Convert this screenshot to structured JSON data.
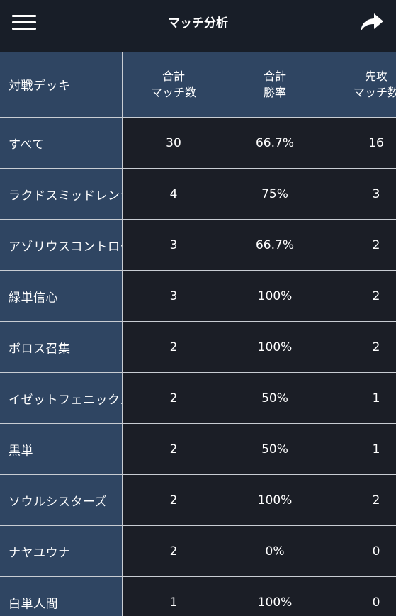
{
  "header": {
    "title": "マッチ分析"
  },
  "table": {
    "columns": {
      "deck": "対戦デッキ",
      "total_matches": [
        "合計",
        "マッチ数"
      ],
      "total_winrate": [
        "合計",
        "勝率"
      ],
      "first_matches": [
        "先攻",
        "マッチ数"
      ]
    },
    "rows": [
      {
        "deck": "すべて",
        "total": "30",
        "winrate": "66.7%",
        "first": "16"
      },
      {
        "deck": "ラクドスミッドレンジ",
        "total": "4",
        "winrate": "75%",
        "first": "3"
      },
      {
        "deck": "アゾリウスコントロール",
        "total": "3",
        "winrate": "66.7%",
        "first": "2"
      },
      {
        "deck": "緑単信心",
        "total": "3",
        "winrate": "100%",
        "first": "2"
      },
      {
        "deck": "ボロス召集",
        "total": "2",
        "winrate": "100%",
        "first": "2"
      },
      {
        "deck": "イゼットフェニックス",
        "total": "2",
        "winrate": "50%",
        "first": "1"
      },
      {
        "deck": "黒単",
        "total": "2",
        "winrate": "50%",
        "first": "1"
      },
      {
        "deck": "ソウルシスターズ",
        "total": "2",
        "winrate": "100%",
        "first": "2"
      },
      {
        "deck": "ナヤユウナ",
        "total": "2",
        "winrate": "0%",
        "first": "0"
      },
      {
        "deck": "白単人間",
        "total": "1",
        "winrate": "100%",
        "first": "0"
      }
    ]
  },
  "colors": {
    "header_bg": "#181e28",
    "deck_column_bg": "#2f4562",
    "data_bg": "#1b1e26",
    "grid_line": "#c9cdd3"
  }
}
